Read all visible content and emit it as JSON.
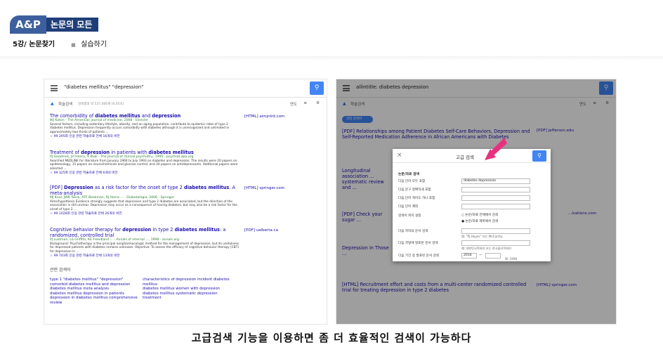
{
  "header": {
    "brand": "A&P",
    "title": "논문의 모든 것",
    "lesson": "5강/ 논문찾기",
    "sublesson": "실습하기"
  },
  "left": {
    "query": "\"diabetes mellitus\" \"depression\"",
    "scholar_label": "학술검색",
    "count": "검색결과 약 537,000개 (0.05초)",
    "year_filter": "연도",
    "results": [
      {
        "title_pre": "The comorbidity of ",
        "title_b1": "diabetes mellitus",
        "title_mid": " and ",
        "title_b2": "depression",
        "link": "[HTML] aimjnlrd.com",
        "meta": "WJ Katon - The American journal of medicine, 2008 - Elsevier",
        "snippet": "Several factors, including sedentary lifestyle, obesity, and an aging population, contribute to epidemic rates of type 2 diabetes mellitus. Depression frequently occurs comorbidly with diabetes although it is unrecognized and untreated in approximately two thirds of patients ...",
        "actions": "☆  99  295회 인용  관련 학술자료  전체 16개의 버전"
      },
      {
        "title_pre": "Treatment of ",
        "title_b1": "depression",
        "title_mid": " in patients with ",
        "title_b2": "diabetes mellitus",
        "link": "",
        "meta": "PJ Goodnick, JH Henry, V Buki - The Journal of clinical psychiatry, 1995 - psychiat.apa.org",
        "snippet": "Searched MEDLINE for literature from January 1966 to July 1993 on diabetes and depression. The results were 20 papers on epidemiology, 15 papers on neurochemicals and glucose control, and 20 papers on antidepressants. Additional papers were selected ...",
        "actions": "☆  99  325회 인용  관련 학술자료  전체 6개의 버전"
      },
      {
        "title_pre": "[PDF] ",
        "title_b1": "Depression",
        "title_mid": " as a risk factor for the onset of type 2 ",
        "title_b2": "diabetes mellitus",
        "title_post": ". A meta-analysis",
        "link": "[HTML] springer.com",
        "meta": "MJ Knol, JWR Twisk, ATF Beekman, RJ Heine ... - Diabetologia, 2006 - Springer",
        "snippet": "Aims/hypothesis Evidence strongly suggests that depression and type 2 diabetes are associated, but the direction of the association is still unclear. Depression may occur as a consequence of having diabetes, but may also be a risk factor for the onset of type 2 ...",
        "actions": "☆  99  1028회 인용  관련 학술자료  전체 26개의 버전"
      },
      {
        "title_pre": "Cognitive behavior therapy for ",
        "title_b1": "depression",
        "title_mid": " in type 2 ",
        "title_b2": "diabetes mellitus",
        "title_post": ": a randomized, controlled trial",
        "link": "[PDF] ualberta.ca",
        "meta": "PJ Lustman, LS Griffith, KE Freedland ... - Annals of internal ..., 1998 - annals.org",
        "snippet": "Background: Psychotherapy is the principal nonpharmacologic method for the management of depression, but its usefulness for depressed patients with diabetes remains unknown. Objective: To assess the efficacy of cognitive behavior therapy (CBT) for depression in ...",
        "actions": "☆  99  703회 인용  관련 학술자료  전체 13개의 버전"
      }
    ],
    "related_title": "관련 검색어",
    "related_col1": [
      "type 1 \"diabetes mellitus\" \"depression\"",
      "comorbid diabetes mellitus and depression",
      "diabetes mellitus meta analysis",
      "diabetes mellitus depression in patients",
      "depression in diabetes mellitus comprehensive review"
    ],
    "related_col2": [
      "characteristics of depression incident diabetes mellitus",
      "diabetes mellitus women with depression",
      "diabetes mellitus systematic depression treatment"
    ]
  },
  "right": {
    "query": "allintitle: diabetes depression",
    "scholar_label": "학술검색",
    "pill": "관련 검색어",
    "year_filter": "연도",
    "results": [
      {
        "title": "[PDF] Relationships among Patient Diabetes Self-Care Behaviors, Depression and Self-Reported Medication Adherence in African Americans with Diabetes",
        "link": "[PDF] jefferson.edu"
      },
      {
        "title": "Longitudinal association ... systematic review and ...",
        "link": ""
      },
      {
        "title": "[PDF] Check your sugar ...",
        "link": "...ications.com"
      },
      {
        "title": "Depression in Those ...",
        "link": ""
      },
      {
        "title": "[HTML] Recruitment effort and costs from a multi-center randomized controlled trial for treating depression in type 2 diabetes",
        "link": "[HTML] springer.com"
      }
    ],
    "dialog": {
      "title": "고급 검색",
      "section": "논문/자료 검색",
      "rows": [
        {
          "label": "다음 단어 모두 포함",
          "value": "diabetes depression"
        },
        {
          "label": "다음 문구 정확하게 포함",
          "value": ""
        },
        {
          "label": "다음 단어 적어도 하나 포함",
          "value": ""
        },
        {
          "label": "다음 단어 제외",
          "value": ""
        }
      ],
      "where_label": "검색어 위치 설정",
      "radio1": "논문/자료 전체에서 검색",
      "radio2": "논문/자료 제목에서 검색",
      "author_label": "다음 저자의 문서 검색",
      "author_hint": "예: \"PJ Hayes\" 또는 McCarthy",
      "pub_label": "다음 저널에 발표된 문서 검색",
      "pub_hint": "예: 대한민국학회지 또는 한국물리학회지",
      "date_label": "다음 기간 중 발표된 문서 검색",
      "year_from": "2016",
      "year_sep": "—",
      "year_hint": "예: 1996"
    }
  },
  "caption": "고급검색 기능을 이용하면 좀 더 효율적인 검색이 가능하다",
  "colors": {
    "accent": "#4285f4",
    "brand": "#1f3e78",
    "arrow": "#e8317e"
  }
}
